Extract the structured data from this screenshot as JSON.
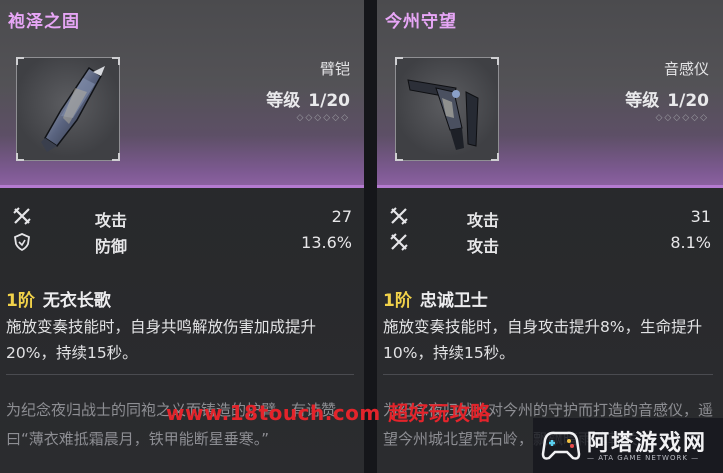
{
  "cards": [
    {
      "title": "袍泽之固",
      "type": "臂铠",
      "level_label": "等级",
      "level_value": "1/20",
      "stars": "◇◇◇◇◇◇",
      "stats": [
        {
          "icon": "attack-icon",
          "name": "攻击",
          "value": "27"
        },
        {
          "icon": "defense-icon",
          "name": "防御",
          "value": "13.6%"
        }
      ],
      "skill_tier": "1阶",
      "skill_name": "无衣长歌",
      "skill_desc": "施放变奏技能时，自身共鸣解放伤害加成提升20%，持续15秒。",
      "lore": "为纪念夜归战士的同袍之义而铸造的护臂，有诗赞曰“薄衣难抵霜晨月，铁甲能断星垂寒。”"
    },
    {
      "title": "今州守望",
      "type": "音感仪",
      "level_label": "等级",
      "level_value": "1/20",
      "stars": "◇◇◇◇◇◇",
      "stats": [
        {
          "icon": "attack-icon",
          "name": "攻击",
          "value": "31"
        },
        {
          "icon": "attack-icon",
          "name": "攻击",
          "value": "8.1%"
        }
      ],
      "skill_tier": "1阶",
      "skill_name": "忠诚卫士",
      "skill_desc": "施放变奏技能时，自身攻击提升8%，生命提升10%，持续15秒。",
      "lore": "为纪念夜归战士对今州的守护而打造的音感仪，遥望今州城北望荒石岭，飘飖暗雨遮朝关。"
    }
  ],
  "watermark": "www.18touch.com  超好玩攻略",
  "logo": {
    "name": "阿塔游戏网",
    "sub": "— ATA GAME NETWORK —"
  },
  "colors": {
    "title": "#e7a6f6",
    "tier": "#f1d24a",
    "watermark": "#e3242b",
    "accent": "#b47ad0"
  }
}
